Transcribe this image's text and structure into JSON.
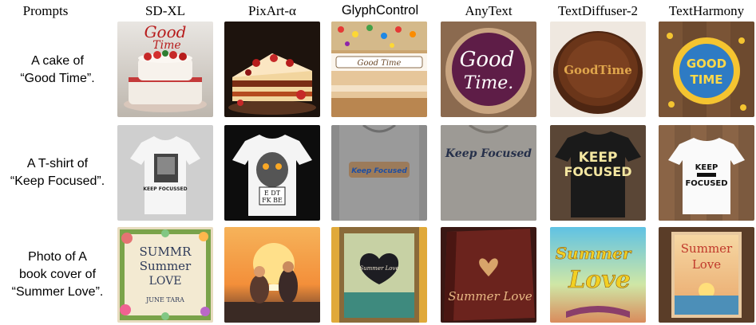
{
  "figure": {
    "columns": [
      {
        "label": "Prompts"
      },
      {
        "label": "SD-XL"
      },
      {
        "label": "PixArt-α"
      },
      {
        "label": "GlyphControl"
      },
      {
        "label": "AnyText"
      },
      {
        "label": "TextDiffuser-2"
      },
      {
        "label": "TextHarmony"
      }
    ],
    "rows": [
      {
        "prompt_line1": "A cake of",
        "prompt_line2": "“Good Time”.",
        "sdxl_text": [
          "Good",
          "Time"
        ],
        "glyph_text": "Good Time",
        "anytext_text": [
          "Good",
          "Time."
        ],
        "td2_text": "GoodTime",
        "harmony_text": [
          "GOOD",
          "TIME"
        ]
      },
      {
        "prompt_line1": "A T-shirt of",
        "prompt_line2": "“Keep Focused”.",
        "sdxl_text": "KEEP FOCUSSED",
        "pixart_text": [
          "E DT",
          "FK BE"
        ],
        "glyph_text": "Keep Focused",
        "anytext_text": "Keep Focused",
        "td2_text": [
          "KEEP",
          "FOCUSED"
        ],
        "harmony_text": [
          "KEEP",
          "FOCUSED"
        ]
      },
      {
        "prompt_line1": "Photo of A",
        "prompt_line2": "book cover of",
        "prompt_line3": "“Summer Love”.",
        "sdxl_text": [
          "SUMMR",
          "Summer",
          "LOVE",
          "JUNE TARA"
        ],
        "glyph_text": "Summer Love",
        "anytext_text": "Summer Love",
        "td2_text": [
          "Summer",
          "Love"
        ],
        "harmony_text": [
          "Summer",
          "Love"
        ]
      }
    ]
  }
}
